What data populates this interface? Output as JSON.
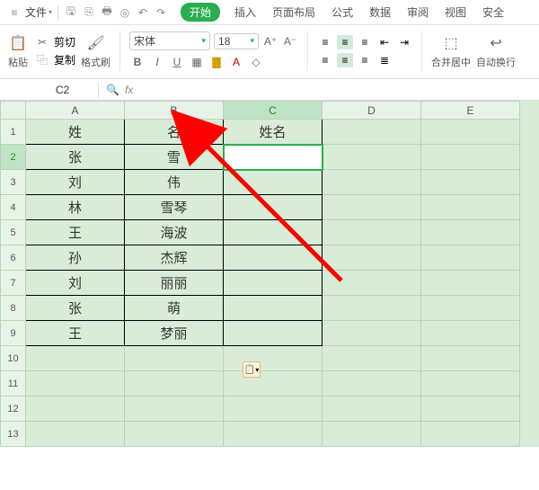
{
  "menu": {
    "file": "文件",
    "tabs": [
      "开始",
      "插入",
      "页面布局",
      "公式",
      "数据",
      "审阅",
      "视图",
      "安全"
    ]
  },
  "ribbon": {
    "paste": "粘贴",
    "cut": "剪切",
    "copy": "复制",
    "format_painter": "格式刷",
    "font": "宋体",
    "font_size": "18",
    "merge": "合并居中",
    "wrap": "自动换行"
  },
  "namebox": "C2",
  "columns": [
    "A",
    "B",
    "C",
    "D",
    "E"
  ],
  "rows": [
    "1",
    "2",
    "3",
    "4",
    "5",
    "6",
    "7",
    "8",
    "9",
    "10",
    "11",
    "12",
    "13"
  ],
  "table": {
    "headerA": "姓",
    "headerB": "名",
    "headerC": "姓名",
    "data": [
      {
        "a": "张",
        "b": "雪"
      },
      {
        "a": "刘",
        "b": "伟"
      },
      {
        "a": "林",
        "b": "雪琴"
      },
      {
        "a": "王",
        "b": "海波"
      },
      {
        "a": "孙",
        "b": "杰辉"
      },
      {
        "a": "刘",
        "b": "丽丽"
      },
      {
        "a": "张",
        "b": "萌"
      },
      {
        "a": "王",
        "b": "梦丽"
      }
    ]
  },
  "annotation": {
    "type": "arrow",
    "color": "#ff0000"
  }
}
